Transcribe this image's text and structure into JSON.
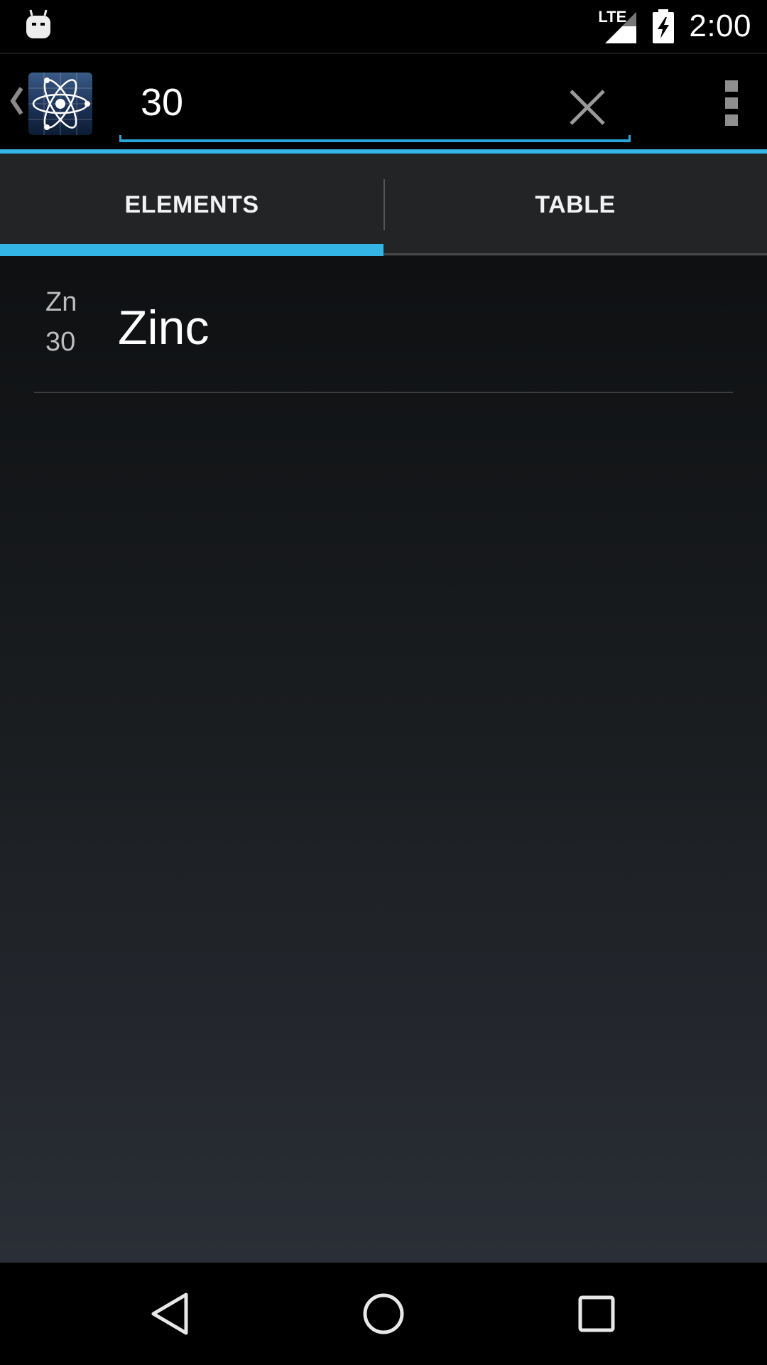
{
  "status_bar": {
    "time": "2:00",
    "network_label": "LTE",
    "icons": [
      "android-notification-icon",
      "signal-icon",
      "battery-charging-icon"
    ]
  },
  "action_bar": {
    "search": {
      "value": "30",
      "placeholder": ""
    },
    "icons": [
      "up-caret-icon",
      "atom-app-icon",
      "clear-icon",
      "overflow-menu-icon"
    ]
  },
  "tabs": [
    {
      "label": "ELEMENTS",
      "selected": true
    },
    {
      "label": "TABLE",
      "selected": false
    }
  ],
  "results": [
    {
      "symbol": "Zn",
      "number": "30",
      "name": "Zinc"
    }
  ],
  "nav_bar": {
    "icons": [
      "back-icon",
      "home-icon",
      "recents-icon"
    ]
  },
  "colors": {
    "accent": "#33b5e5",
    "search_underline": "#29a6d8",
    "tab_bar_bg": "#222426",
    "content_bg_top": "#0e1012",
    "content_bg_bottom": "#2a2e36"
  }
}
